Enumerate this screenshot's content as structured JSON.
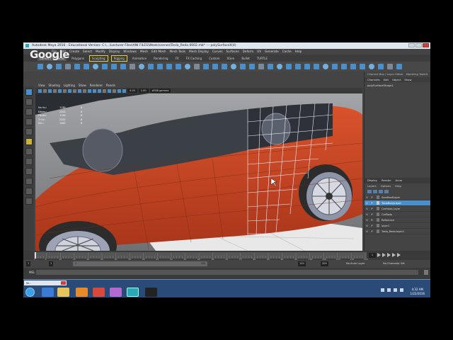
{
  "window": {
    "title": "Autodesk Maya 2016 - Educational Version: C:\\...\\Lecturer Files\\ANI FILES\\Week\\scenes\\Tesla_Redo.0002.mb* --- polySurfaceX(4)"
  },
  "overlay": {
    "logo": "Google"
  },
  "menubar": {
    "items": [
      "File",
      "Edit",
      "Create",
      "Select",
      "Modify",
      "Display",
      "Windows",
      "Mesh",
      "Edit Mesh",
      "Mesh Tools",
      "Mesh Display",
      "Curves",
      "Surfaces",
      "Deform",
      "UV",
      "Generate",
      "Cache",
      "Help"
    ]
  },
  "shelf": {
    "tabs": [
      "Curves / Surfaces",
      "Polygons",
      "Sculpting",
      "Rigging",
      "Animation",
      "Rendering",
      "FX",
      "FX Caching",
      "Custom",
      "XGen",
      "Bullet",
      "TURTLE"
    ],
    "active_tab": "Curves / Surfaces"
  },
  "viewport": {
    "menu": [
      "View",
      "Shading",
      "Lighting",
      "Show",
      "Renderer",
      "Panels"
    ],
    "gamma_field": "sRGB gamma",
    "value_left": "0.00",
    "value_right": "1.00",
    "hud": {
      "rows": [
        {
          "label": "Verts:",
          "a": "1130",
          "b": "0"
        },
        {
          "label": "Edges:",
          "a": "2253",
          "b": "0"
        },
        {
          "label": "Faces:",
          "a": "1126",
          "b": "0"
        },
        {
          "label": "Tris:",
          "a": "2252",
          "b": "0"
        },
        {
          "label": "UVs:",
          "a": "1262",
          "b": "0"
        }
      ]
    }
  },
  "channel_box": {
    "tabs": [
      "Channel Box / Layer Editor",
      "Modeling Toolkit"
    ],
    "menu": [
      "Channels",
      "Edit",
      "Object",
      "Show"
    ],
    "object": "polySurfaceShape1"
  },
  "layer_editor": {
    "tabs": [
      "Display",
      "Render",
      "Anim"
    ],
    "menu": [
      "Layers",
      "Options",
      "Help"
    ],
    "layers": [
      {
        "v": "V",
        "p": "P",
        "name": "SamRoofLayer",
        "selected": false
      },
      {
        "v": "V",
        "p": "P",
        "name": "TeslaBodyLayer",
        "selected": true
      },
      {
        "v": "V",
        "p": "P",
        "name": "CarHood_layer",
        "selected": false
      },
      {
        "v": "V",
        "p": "P",
        "name": "CarBody",
        "selected": false
      },
      {
        "v": "V",
        "p": "R",
        "name": "Reference",
        "selected": false
      },
      {
        "v": "V",
        "p": "P",
        "name": "layer1",
        "selected": false
      },
      {
        "v": "V",
        "p": "P",
        "name": "Tesla_Redo:layer1",
        "selected": false
      }
    ]
  },
  "timeline": {
    "labels": [
      "1",
      "5",
      "10",
      "15",
      "20",
      "25",
      "30",
      "35",
      "40",
      "45",
      "50",
      "55",
      "60",
      "65",
      "70",
      "75",
      "80",
      "85",
      "90",
      "95",
      "100",
      "105",
      "110",
      "115",
      "120"
    ],
    "current_frame": "1"
  },
  "range": {
    "start": "1",
    "start_inner": "1",
    "slider_start": "1",
    "slider_end": "120",
    "end_inner": "120",
    "end": "200",
    "anim_layer": "No Anim Layer",
    "character_set": "No Character Set"
  },
  "command_line": {
    "label": "MEL"
  },
  "taskbar": {
    "mini_window": "W...",
    "clock_time": "4:32 AM",
    "clock_date": "1/22/2016"
  },
  "colors": {
    "car_body": "#c9411f",
    "car_shadow": "#8f2a12",
    "viewport_bg": "#8a8c90",
    "selection_blue": "#4a8fc9",
    "taskbar": "#2a4a78"
  }
}
